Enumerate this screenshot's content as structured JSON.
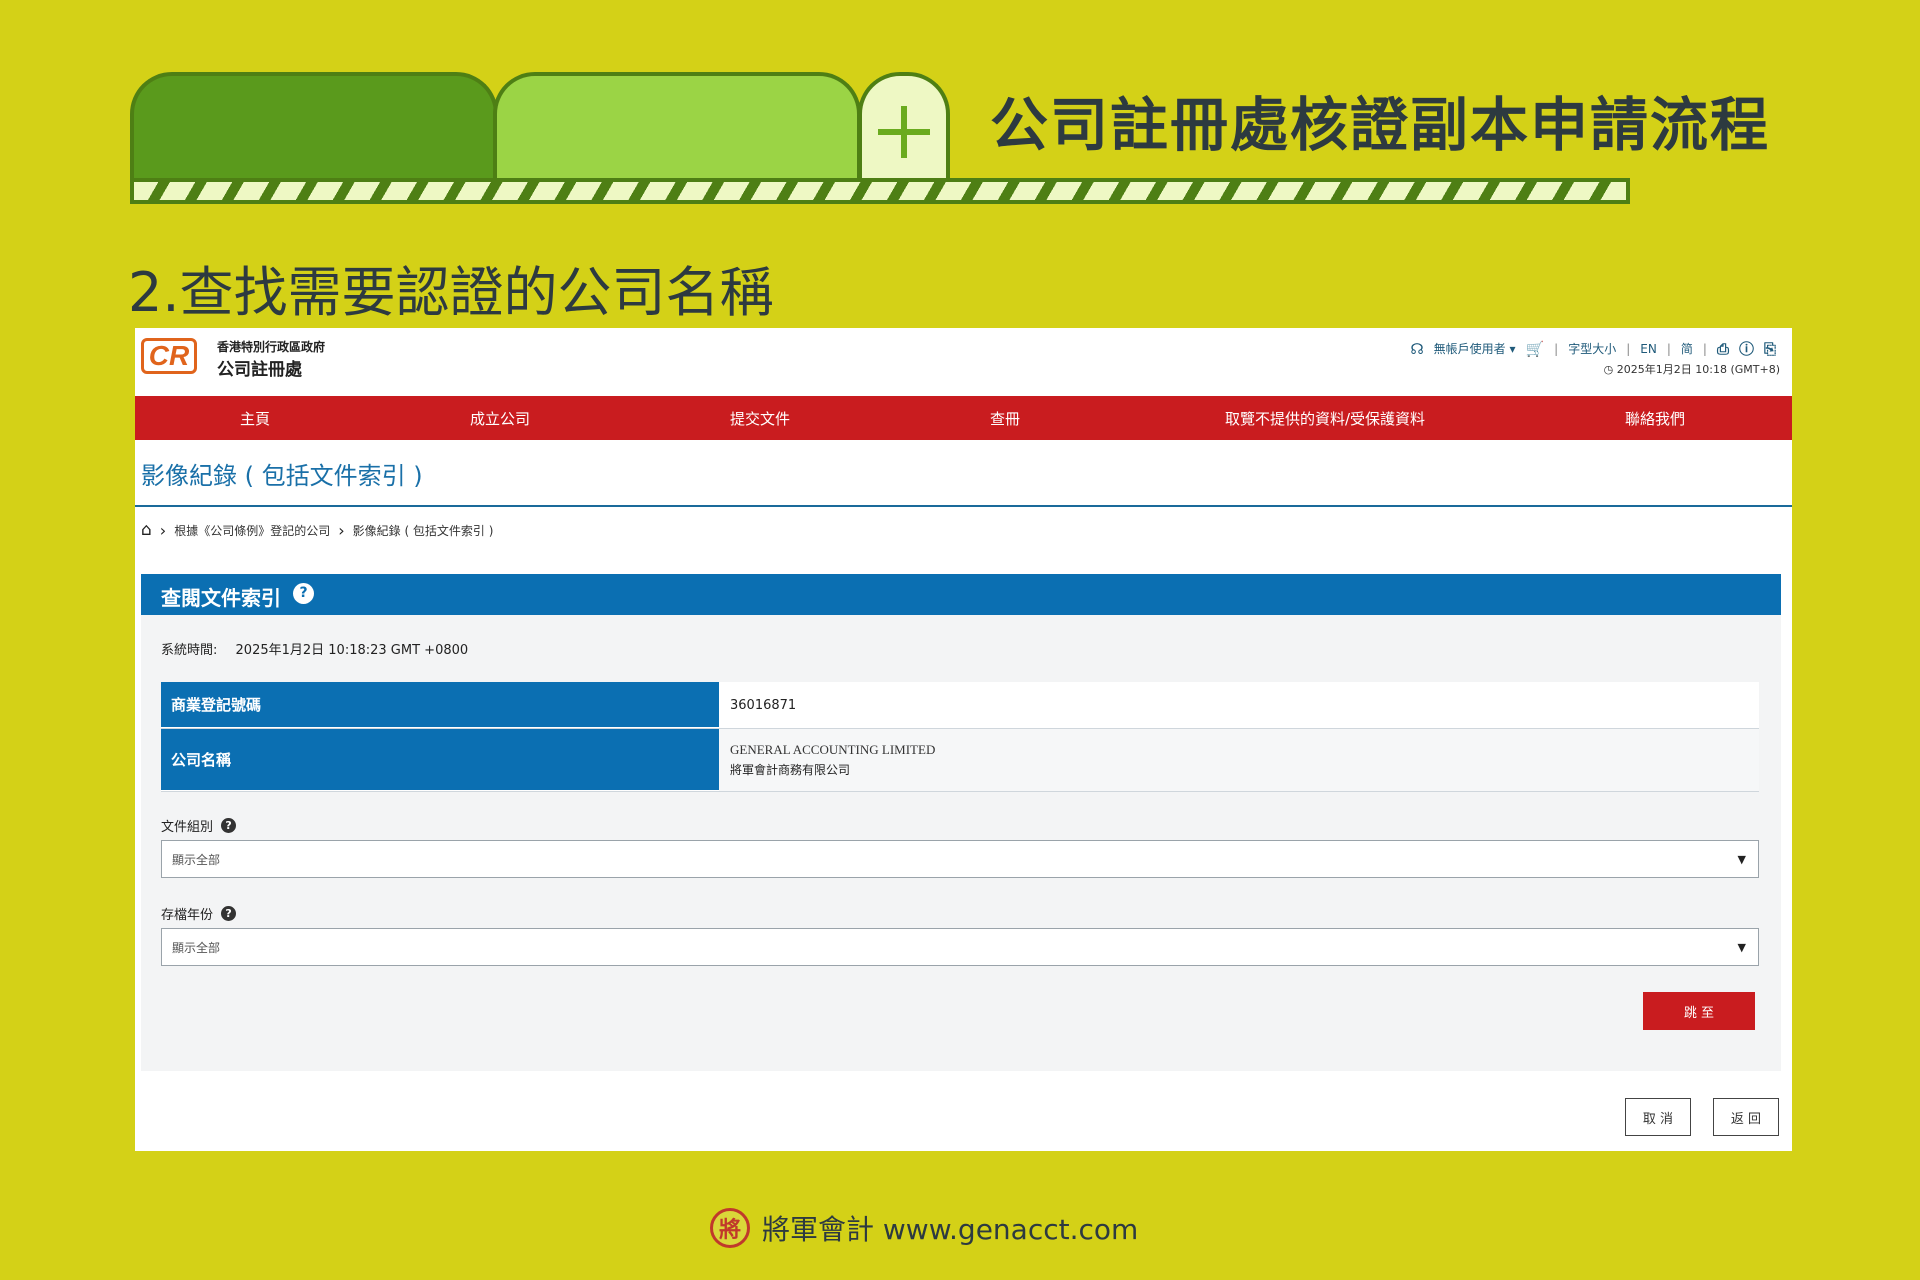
{
  "slide": {
    "title": "公司註冊處核證副本申請流程",
    "step_title": "2.查找需要認證的公司名稱",
    "footer": "將軍會計 www.genacct.com",
    "seal_glyph": "將"
  },
  "site": {
    "logo_text": "CR",
    "org_sub": "香港特別行政區政府",
    "org_main": "公司註冊處",
    "utility": {
      "user": "無帳戶使用者 ▾",
      "font_size": "字型大小",
      "lang_en": "EN",
      "lang_sc": "简"
    },
    "clock": "2025年1月2日 10:18 (GMT+8)"
  },
  "nav": [
    "主頁",
    "成立公司",
    "提交文件",
    "查冊",
    "取覽不提供的資料/受保護資料",
    "聯絡我們"
  ],
  "page": {
    "heading": "影像紀錄 ( 包括文件索引 )",
    "breadcrumb": [
      "根據《公司條例》登記的公司",
      "影像紀錄 ( 包括文件索引 )"
    ]
  },
  "section": {
    "title": "查閱文件索引",
    "system_time_label": "系統時間:",
    "system_time_value": "2025年1月2日 10:18:23 GMT +0800",
    "table": {
      "brn_label": "商業登記號碼",
      "brn_value": "36016871",
      "name_label": "公司名稱",
      "name_en": "GENERAL ACCOUNTING LIMITED",
      "name_zh": "將軍會計商務有限公司"
    },
    "doc_group_label": "文件組別",
    "doc_group_value": "顯示全部",
    "year_label": "存檔年份",
    "year_value": "顯示全部",
    "go_button": "跳 至"
  },
  "buttons": {
    "cancel": "取 消",
    "back": "返 回"
  },
  "colors": {
    "background": "#d4d117",
    "nav_red": "#c91c1f",
    "header_blue": "#0b6fb2"
  }
}
